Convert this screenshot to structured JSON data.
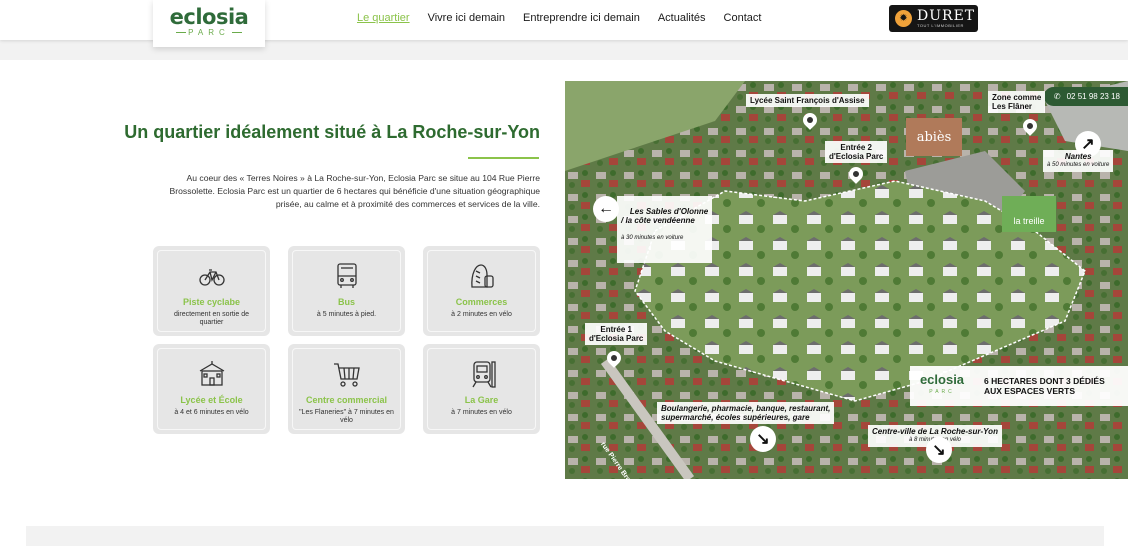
{
  "header": {
    "logo_name": "eclosia",
    "logo_sub": "PARC",
    "nav": [
      {
        "label": "Le quartier",
        "active": true
      },
      {
        "label": "Vivre ici demain",
        "active": false
      },
      {
        "label": "Entreprendre ici demain",
        "active": false
      },
      {
        "label": "Actualités",
        "active": false
      },
      {
        "label": "Contact",
        "active": false
      }
    ],
    "partner_name": "DURET",
    "partner_tag": "TOUT L'IMMOBILIER"
  },
  "section": {
    "title": "Un quartier idéalement situé à La Roche-sur-Yon",
    "intro": "Au coeur des « Terres Noires » à La Roche-sur-Yon, Eclosia Parc se situe au 104 Rue Pierre Brossolette. Eclosia Parc est un quartier de 6 hectares qui bénéficie d'une situation géographique prisée, au calme et à proximité des commerces et services de la ville."
  },
  "cards": [
    {
      "icon": "bicycle-icon",
      "title": "Piste cyclabe",
      "sub": "directement en sortie de quartier"
    },
    {
      "icon": "bus-icon",
      "title": "Bus",
      "sub": "à 5 minutes à pied."
    },
    {
      "icon": "bread-icon",
      "title": "Commerces",
      "sub": "à 2 minutes en vélo"
    },
    {
      "icon": "school-icon",
      "title": "Lycée et École",
      "sub": "à 4 et 6 minutes en vélo"
    },
    {
      "icon": "shopping-cart-icon",
      "title": "Centre commercial",
      "sub": "\"Les Flaneries\" à 7 minutes en vélo"
    },
    {
      "icon": "train-icon",
      "title": "La Gare",
      "sub": "à 7 minutes en vélo"
    }
  ],
  "map": {
    "phone": "02 51 98 23 18",
    "lycee": "Lycée Saint François d'Assise",
    "zone": "Zone comme\nLes Flâner",
    "entree2": "Entrée 2\nd'Eclosia Parc",
    "abies": "abiès",
    "nantes": "Nantes",
    "nantes_sub": "à 50 minutes en voiture",
    "sables": "Les Sables d'Olonne\n/ la côte vendéenne",
    "sables_sub": "à 30 minutes en voiture",
    "treille": "la treille",
    "entree1": "Entrée 1\nd'Eclosia Parc",
    "services": "Boulangerie, pharmacie, banque, restaurant,\nsupermarché, écoles supérieures, gare",
    "street": "rue Pierre Brossolette",
    "centre": "Centre-ville de La Roche-sur-Yon",
    "centre_sub": "à 8 minutes en vélo",
    "banner_logo": "eclosia",
    "banner_logo_sub": "PARC",
    "banner_text": "6 HECTARES DONT 3 DÉDIÉS\nAUX ESPACES VERTS"
  }
}
